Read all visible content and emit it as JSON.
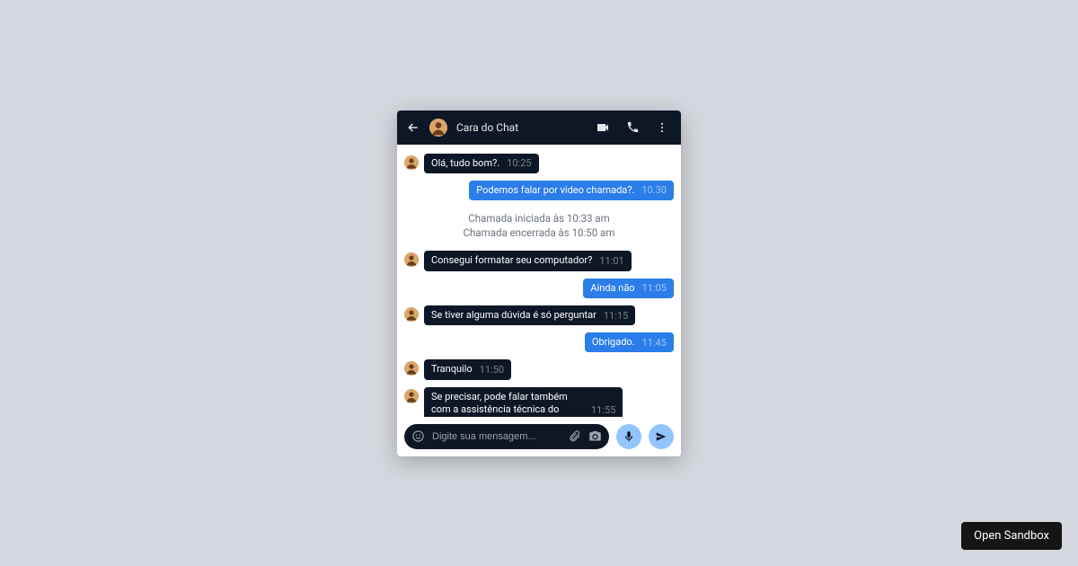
{
  "header": {
    "title": "Cara do Chat"
  },
  "messages": [
    {
      "side": "left",
      "type": "msg",
      "text": "Olá, tudo bom?.",
      "time": "10:25"
    },
    {
      "side": "right",
      "type": "msg",
      "text": "Podemos falar por video chamada?.",
      "time": "10.30"
    },
    {
      "type": "system",
      "line1": "Chamada iniciada às 10:33 am",
      "line2": "Chamada encerrada às 10:50 am"
    },
    {
      "side": "left",
      "type": "msg",
      "text": "Consegui formatar seu computador?",
      "time": "11:01"
    },
    {
      "side": "right",
      "type": "msg",
      "text": "Ainda não",
      "time": "11:05"
    },
    {
      "side": "left",
      "type": "msg",
      "text": "Se tiver alguma dúvida é só perguntar",
      "time": "11:15"
    },
    {
      "side": "right",
      "type": "msg",
      "text": "Obrigado.",
      "time": "11:45"
    },
    {
      "side": "left",
      "type": "msg",
      "text": "Tranquilo",
      "time": "11:50"
    },
    {
      "side": "left",
      "type": "msg",
      "multiline": true,
      "text": "Se precisar, pode falar também com a assistência técnica do ACME Comp",
      "time": "11:55"
    }
  ],
  "composer": {
    "placeholder": "Digite sua mensagem..."
  },
  "sandbox_button": "Open Sandbox"
}
